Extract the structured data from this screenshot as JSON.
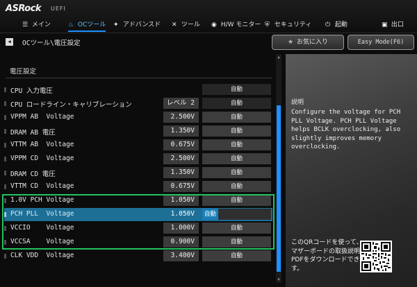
{
  "brand": {
    "logo": "ASRock",
    "sub": "UEFI"
  },
  "tabs": [
    {
      "label": "メイン",
      "icon": "list-icon",
      "glyph": "☰",
      "active": false
    },
    {
      "label": "OCツール",
      "icon": "flame-icon",
      "glyph": "♨",
      "active": true
    },
    {
      "label": "アドバンスド",
      "icon": "star-icon",
      "glyph": "✦",
      "active": false
    },
    {
      "label": "ツール",
      "icon": "wrench-icon",
      "glyph": "✕",
      "active": false
    },
    {
      "label": "H/W モニター",
      "icon": "monitor-icon",
      "glyph": "◉",
      "active": false
    },
    {
      "label": "セキュリティ",
      "icon": "shield-icon",
      "glyph": "⛨",
      "active": false
    },
    {
      "label": "起動",
      "icon": "power-icon",
      "glyph": "⏻",
      "active": false
    },
    {
      "label": "出口",
      "icon": "exit-icon",
      "glyph": "▣",
      "active": false
    }
  ],
  "breadcrumb": "OCツール\\電圧設定",
  "favorites_label": "お気に入り",
  "easy_mode_label": "Easy Mode(F6)",
  "section_title": "電圧設定",
  "rows": [
    {
      "label": "CPU 入力電圧",
      "value": "",
      "mode": "自動"
    },
    {
      "label": "CPU ロードライン・キャリブレーション",
      "value": "レベル 2",
      "mode": "自動"
    },
    {
      "label": "VPPM AB  Voltage",
      "value": "2.500V",
      "mode": "自動"
    },
    {
      "label": "DRAM AB 電圧",
      "value": "1.350V",
      "mode": "自動"
    },
    {
      "label": "VTTM AB  Voltage",
      "value": "0.675V",
      "mode": "自動"
    },
    {
      "label": "VPPM CD  Voltage",
      "value": "2.500V",
      "mode": "自動"
    },
    {
      "label": "DRAM CD 電圧",
      "value": "1.350V",
      "mode": "自動"
    },
    {
      "label": "VTTM CD  Voltage",
      "value": "0.675V",
      "mode": "自動"
    },
    {
      "label": "1.0V PCH Voltage",
      "value": "1.050V",
      "mode": "自動"
    },
    {
      "label": "PCH PLL  Voltage",
      "value": "1.050V",
      "mode": "自動",
      "selected": true
    },
    {
      "label": "VCCIO    Voltage",
      "value": "1.000V",
      "mode": "自動"
    },
    {
      "label": "VCCSA    Voltage",
      "value": "0.900V",
      "mode": "自動"
    },
    {
      "label": "CLK VDD  Voltage",
      "value": "3.400V",
      "mode": "自動"
    }
  ],
  "help": {
    "title": "説明",
    "text": "Configure the voltage for PCH PLL Voltage. PCH PLL Voltage helps BCLK overclocking, also slightly improves memory overclocking.",
    "qr_text": "このQRコードを使って、マザーボードの取扱説明書PDFをダウンロードできます。"
  },
  "colors": {
    "accent": "#1e90ff",
    "selected_row": "#1d6f96",
    "highlight_box": "#22c55e"
  }
}
